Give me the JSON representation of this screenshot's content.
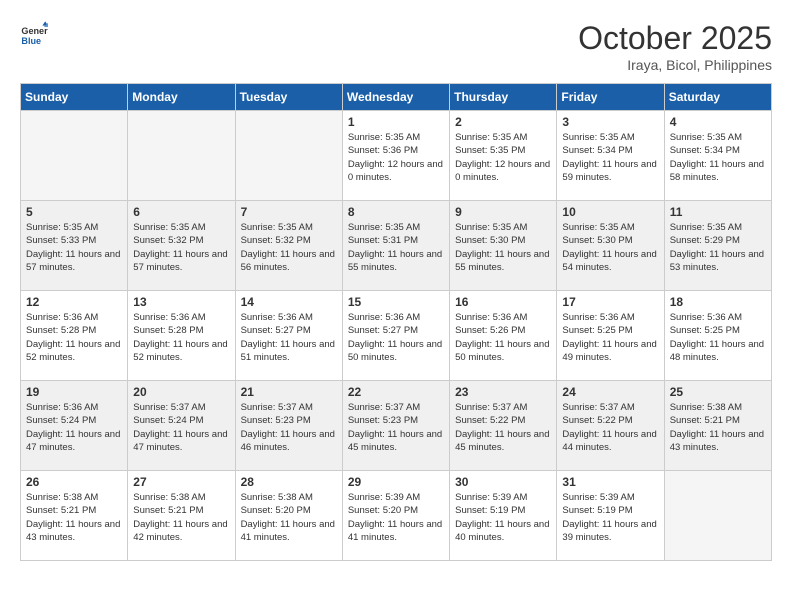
{
  "header": {
    "logo_line1": "General",
    "logo_line2": "Blue",
    "month": "October 2025",
    "location": "Iraya, Bicol, Philippines"
  },
  "weekdays": [
    "Sunday",
    "Monday",
    "Tuesday",
    "Wednesday",
    "Thursday",
    "Friday",
    "Saturday"
  ],
  "weeks": [
    [
      {
        "day": "",
        "empty": true
      },
      {
        "day": "",
        "empty": true
      },
      {
        "day": "",
        "empty": true
      },
      {
        "day": "1",
        "sunrise": "5:35 AM",
        "sunset": "5:36 PM",
        "daylight": "12 hours and 0 minutes."
      },
      {
        "day": "2",
        "sunrise": "5:35 AM",
        "sunset": "5:35 PM",
        "daylight": "12 hours and 0 minutes."
      },
      {
        "day": "3",
        "sunrise": "5:35 AM",
        "sunset": "5:34 PM",
        "daylight": "11 hours and 59 minutes."
      },
      {
        "day": "4",
        "sunrise": "5:35 AM",
        "sunset": "5:34 PM",
        "daylight": "11 hours and 58 minutes."
      }
    ],
    [
      {
        "day": "5",
        "sunrise": "5:35 AM",
        "sunset": "5:33 PM",
        "daylight": "11 hours and 57 minutes."
      },
      {
        "day": "6",
        "sunrise": "5:35 AM",
        "sunset": "5:32 PM",
        "daylight": "11 hours and 57 minutes."
      },
      {
        "day": "7",
        "sunrise": "5:35 AM",
        "sunset": "5:32 PM",
        "daylight": "11 hours and 56 minutes."
      },
      {
        "day": "8",
        "sunrise": "5:35 AM",
        "sunset": "5:31 PM",
        "daylight": "11 hours and 55 minutes."
      },
      {
        "day": "9",
        "sunrise": "5:35 AM",
        "sunset": "5:30 PM",
        "daylight": "11 hours and 55 minutes."
      },
      {
        "day": "10",
        "sunrise": "5:35 AM",
        "sunset": "5:30 PM",
        "daylight": "11 hours and 54 minutes."
      },
      {
        "day": "11",
        "sunrise": "5:35 AM",
        "sunset": "5:29 PM",
        "daylight": "11 hours and 53 minutes."
      }
    ],
    [
      {
        "day": "12",
        "sunrise": "5:36 AM",
        "sunset": "5:28 PM",
        "daylight": "11 hours and 52 minutes."
      },
      {
        "day": "13",
        "sunrise": "5:36 AM",
        "sunset": "5:28 PM",
        "daylight": "11 hours and 52 minutes."
      },
      {
        "day": "14",
        "sunrise": "5:36 AM",
        "sunset": "5:27 PM",
        "daylight": "11 hours and 51 minutes."
      },
      {
        "day": "15",
        "sunrise": "5:36 AM",
        "sunset": "5:27 PM",
        "daylight": "11 hours and 50 minutes."
      },
      {
        "day": "16",
        "sunrise": "5:36 AM",
        "sunset": "5:26 PM",
        "daylight": "11 hours and 50 minutes."
      },
      {
        "day": "17",
        "sunrise": "5:36 AM",
        "sunset": "5:25 PM",
        "daylight": "11 hours and 49 minutes."
      },
      {
        "day": "18",
        "sunrise": "5:36 AM",
        "sunset": "5:25 PM",
        "daylight": "11 hours and 48 minutes."
      }
    ],
    [
      {
        "day": "19",
        "sunrise": "5:36 AM",
        "sunset": "5:24 PM",
        "daylight": "11 hours and 47 minutes."
      },
      {
        "day": "20",
        "sunrise": "5:37 AM",
        "sunset": "5:24 PM",
        "daylight": "11 hours and 47 minutes."
      },
      {
        "day": "21",
        "sunrise": "5:37 AM",
        "sunset": "5:23 PM",
        "daylight": "11 hours and 46 minutes."
      },
      {
        "day": "22",
        "sunrise": "5:37 AM",
        "sunset": "5:23 PM",
        "daylight": "11 hours and 45 minutes."
      },
      {
        "day": "23",
        "sunrise": "5:37 AM",
        "sunset": "5:22 PM",
        "daylight": "11 hours and 45 minutes."
      },
      {
        "day": "24",
        "sunrise": "5:37 AM",
        "sunset": "5:22 PM",
        "daylight": "11 hours and 44 minutes."
      },
      {
        "day": "25",
        "sunrise": "5:38 AM",
        "sunset": "5:21 PM",
        "daylight": "11 hours and 43 minutes."
      }
    ],
    [
      {
        "day": "26",
        "sunrise": "5:38 AM",
        "sunset": "5:21 PM",
        "daylight": "11 hours and 43 minutes."
      },
      {
        "day": "27",
        "sunrise": "5:38 AM",
        "sunset": "5:21 PM",
        "daylight": "11 hours and 42 minutes."
      },
      {
        "day": "28",
        "sunrise": "5:38 AM",
        "sunset": "5:20 PM",
        "daylight": "11 hours and 41 minutes."
      },
      {
        "day": "29",
        "sunrise": "5:39 AM",
        "sunset": "5:20 PM",
        "daylight": "11 hours and 41 minutes."
      },
      {
        "day": "30",
        "sunrise": "5:39 AM",
        "sunset": "5:19 PM",
        "daylight": "11 hours and 40 minutes."
      },
      {
        "day": "31",
        "sunrise": "5:39 AM",
        "sunset": "5:19 PM",
        "daylight": "11 hours and 39 minutes."
      },
      {
        "day": "",
        "empty": true
      }
    ]
  ],
  "labels": {
    "sunrise": "Sunrise:",
    "sunset": "Sunset:",
    "daylight": "Daylight:"
  }
}
